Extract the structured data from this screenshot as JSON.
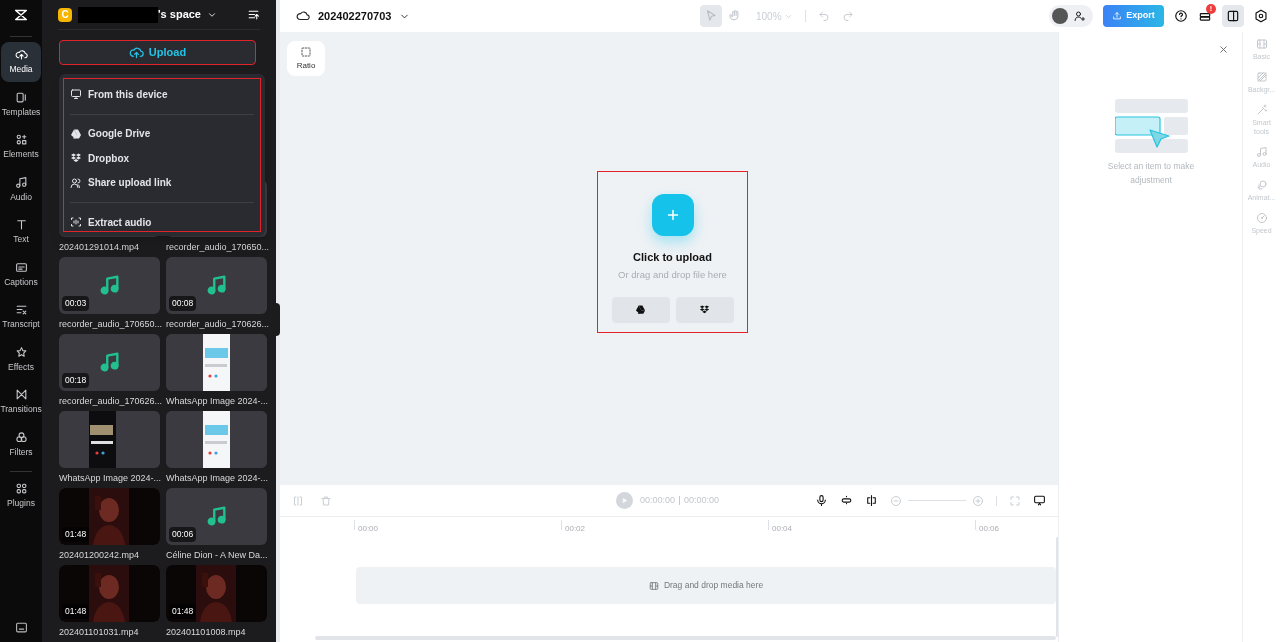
{
  "nav": [
    {
      "label": "Media",
      "selected": true
    },
    {
      "label": "Templates",
      "selected": false
    },
    {
      "label": "Elements",
      "selected": false
    },
    {
      "label": "Audio",
      "selected": false
    },
    {
      "label": "Text",
      "selected": false
    },
    {
      "label": "Captions",
      "selected": false
    },
    {
      "label": "Transcript",
      "selected": false
    },
    {
      "label": "Effects",
      "selected": false
    },
    {
      "label": "Transitions",
      "selected": false
    },
    {
      "label": "Filters",
      "selected": false
    },
    {
      "label": "Plugins",
      "selected": false
    }
  ],
  "workspace": {
    "avatar": "C",
    "name": "'s space"
  },
  "upload_button": "Upload",
  "upload_menu": [
    {
      "kind": "item",
      "label": "From this device"
    },
    {
      "kind": "divider"
    },
    {
      "kind": "item",
      "label": "Google Drive"
    },
    {
      "kind": "item",
      "label": "Dropbox"
    },
    {
      "kind": "item",
      "label": "Share upload link"
    },
    {
      "kind": "divider"
    },
    {
      "kind": "item",
      "label": "Extract audio"
    }
  ],
  "media": [
    {
      "name": "202401291014.mp4"
    },
    {
      "name": "recorder_audio_170650..."
    },
    {
      "kind": "audio",
      "duration": "00:03",
      "name": "recorder_audio_170650..."
    },
    {
      "kind": "audio",
      "duration": "00:08",
      "name": "recorder_audio_170626..."
    },
    {
      "kind": "audio",
      "duration": "00:18",
      "name": "recorder_audio_170626..."
    },
    {
      "name": "WhatsApp Image 2024-..."
    },
    {
      "name": "WhatsApp Image 2024-..."
    },
    {
      "name": "WhatsApp Image 2024-..."
    },
    {
      "kind": "video",
      "duration": "01:48",
      "name": "202401200242.mp4"
    },
    {
      "kind": "audio",
      "duration": "00:06",
      "name": "Céline Dion - A New Da..."
    },
    {
      "kind": "video",
      "duration": "01:48",
      "name": "202401101031.mp4"
    },
    {
      "kind": "video",
      "duration": "01:48",
      "name": "202401101008.mp4"
    }
  ],
  "project": {
    "title": "202402270703"
  },
  "tools": [
    {
      "selected": true
    },
    {
      "selected": false
    }
  ],
  "zoom": "100%",
  "export_button": "Export",
  "notification_badge": "!",
  "ratio_button": "Ratio",
  "upload_card": {
    "title": "Click to upload",
    "subtitle": "Or drag and drop file here"
  },
  "adjust_panel": {
    "hint": "Select an item to make adjustment"
  },
  "right_tabs": [
    {
      "label": "Basic",
      "disabled": true
    },
    {
      "label": "Backgr...",
      "disabled": true
    },
    {
      "label": "Smart tools",
      "disabled": true
    },
    {
      "label": "Audio",
      "disabled": true
    },
    {
      "label": "Animat...",
      "disabled": true
    },
    {
      "label": "Speed",
      "disabled": true
    }
  ],
  "timeline": {
    "zoom_slider": {
      "level": 0
    },
    "current": "00:00:00",
    "total": "00:00:00",
    "ruler": [
      "00:00",
      "00:02",
      "00:04",
      "00:06"
    ],
    "drop_hint": "Drag and drop media here"
  }
}
